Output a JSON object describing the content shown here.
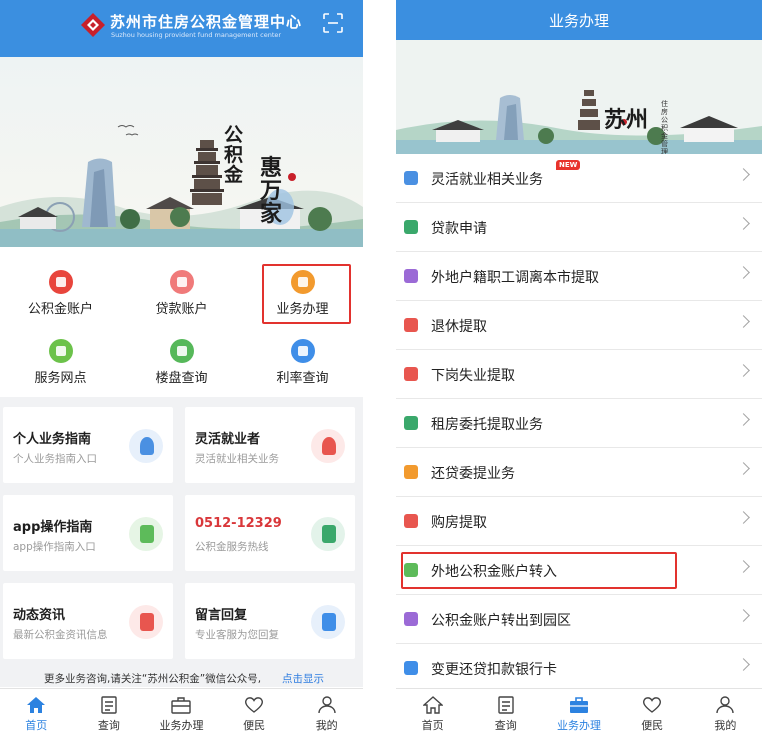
{
  "left": {
    "header": {
      "title": "苏州市住房公积金管理中心",
      "subtitle": "Suzhou housing provident fund management center",
      "scan_icon": "scan-icon"
    },
    "banner": {
      "calligraphy_line1": "公积金",
      "calligraphy_line2": "惠万家"
    },
    "quick_menu": [
      {
        "label": "公积金账户",
        "icon": "account-icon",
        "color": "#e8453c"
      },
      {
        "label": "贷款账户",
        "icon": "loan-icon",
        "color": "#f07a7a"
      },
      {
        "label": "业务办理",
        "icon": "briefcase-icon",
        "color": "#f29a2e"
      },
      {
        "label": "服务网点",
        "icon": "network-icon",
        "color": "#6cc24a"
      },
      {
        "label": "楼盘查询",
        "icon": "building-icon",
        "color": "#56b85a"
      },
      {
        "label": "利率查询",
        "icon": "rate-icon",
        "color": "#3f8ee8"
      }
    ],
    "cards": [
      {
        "title": "个人业务指南",
        "subtitle": "个人业务指南入口",
        "icon": "person-icon",
        "color": "#4a90e2"
      },
      {
        "title": "灵活就业者",
        "subtitle": "灵活就业相关业务",
        "icon": "worker-icon",
        "color": "#e8564f"
      },
      {
        "title": "app操作指南",
        "subtitle": "app操作指南入口",
        "icon": "mobile-icon",
        "color": "#5dbb5a"
      },
      {
        "title": "0512-12329",
        "subtitle": "公积金服务热线",
        "icon": "telephone-icon",
        "color": "#3aa86b"
      },
      {
        "title": "动态资讯",
        "subtitle": "最新公积金资讯信息",
        "icon": "news-icon",
        "color": "#e8564f"
      },
      {
        "title": "留言回复",
        "subtitle": "专业客服为您回复",
        "icon": "message-icon",
        "color": "#3f8ee8"
      }
    ],
    "notice": {
      "text": "更多业务咨询,请关注“苏州公积金”微信公众号,",
      "link": "点击显示"
    },
    "tabbar": [
      {
        "label": "首页",
        "icon": "home-icon",
        "active": true
      },
      {
        "label": "查询",
        "icon": "query-icon",
        "active": false
      },
      {
        "label": "业务办理",
        "icon": "briefcase-icon",
        "active": false
      },
      {
        "label": "便民",
        "icon": "heart-icon",
        "active": false
      },
      {
        "label": "我的",
        "icon": "user-icon",
        "active": false
      }
    ]
  },
  "right": {
    "header": {
      "title": "业务办理"
    },
    "banner": {
      "calligraphy": "苏州",
      "vertical_text": "住房公积金管理中心"
    },
    "menu": [
      {
        "label": "灵活就业相关业务",
        "icon": "flexible-job-icon",
        "color": "#4a90e2",
        "badge": "NEW"
      },
      {
        "label": "贷款申请",
        "icon": "loan-apply-icon",
        "color": "#3aa86b"
      },
      {
        "label": "外地户籍职工调离本市提取",
        "icon": "transfer-out-icon",
        "color": "#9b6ad6"
      },
      {
        "label": "退休提取",
        "icon": "retire-icon",
        "color": "#e8564f"
      },
      {
        "label": "下岗失业提取",
        "icon": "unemployed-icon",
        "color": "#e8564f"
      },
      {
        "label": "租房委托提取业务",
        "icon": "rent-icon",
        "color": "#3aa86b"
      },
      {
        "label": "还贷委提业务",
        "icon": "repay-icon",
        "color": "#f29a2e"
      },
      {
        "label": "购房提取",
        "icon": "purchase-icon",
        "color": "#e8564f"
      },
      {
        "label": "外地公积金账户转入",
        "icon": "transfer-in-icon",
        "color": "#5dbb5a"
      },
      {
        "label": "公积金账户转出到园区",
        "icon": "park-transfer-icon",
        "color": "#9b6ad6"
      },
      {
        "label": "变更还贷扣款银行卡",
        "icon": "bank-card-icon",
        "color": "#3f8ee8"
      }
    ],
    "tabbar": [
      {
        "label": "首页",
        "icon": "home-icon",
        "active": false
      },
      {
        "label": "查询",
        "icon": "query-icon",
        "active": false
      },
      {
        "label": "业务办理",
        "icon": "briefcase-icon",
        "active": true
      },
      {
        "label": "便民",
        "icon": "heart-icon",
        "active": false
      },
      {
        "label": "我的",
        "icon": "user-icon",
        "active": false
      }
    ]
  }
}
